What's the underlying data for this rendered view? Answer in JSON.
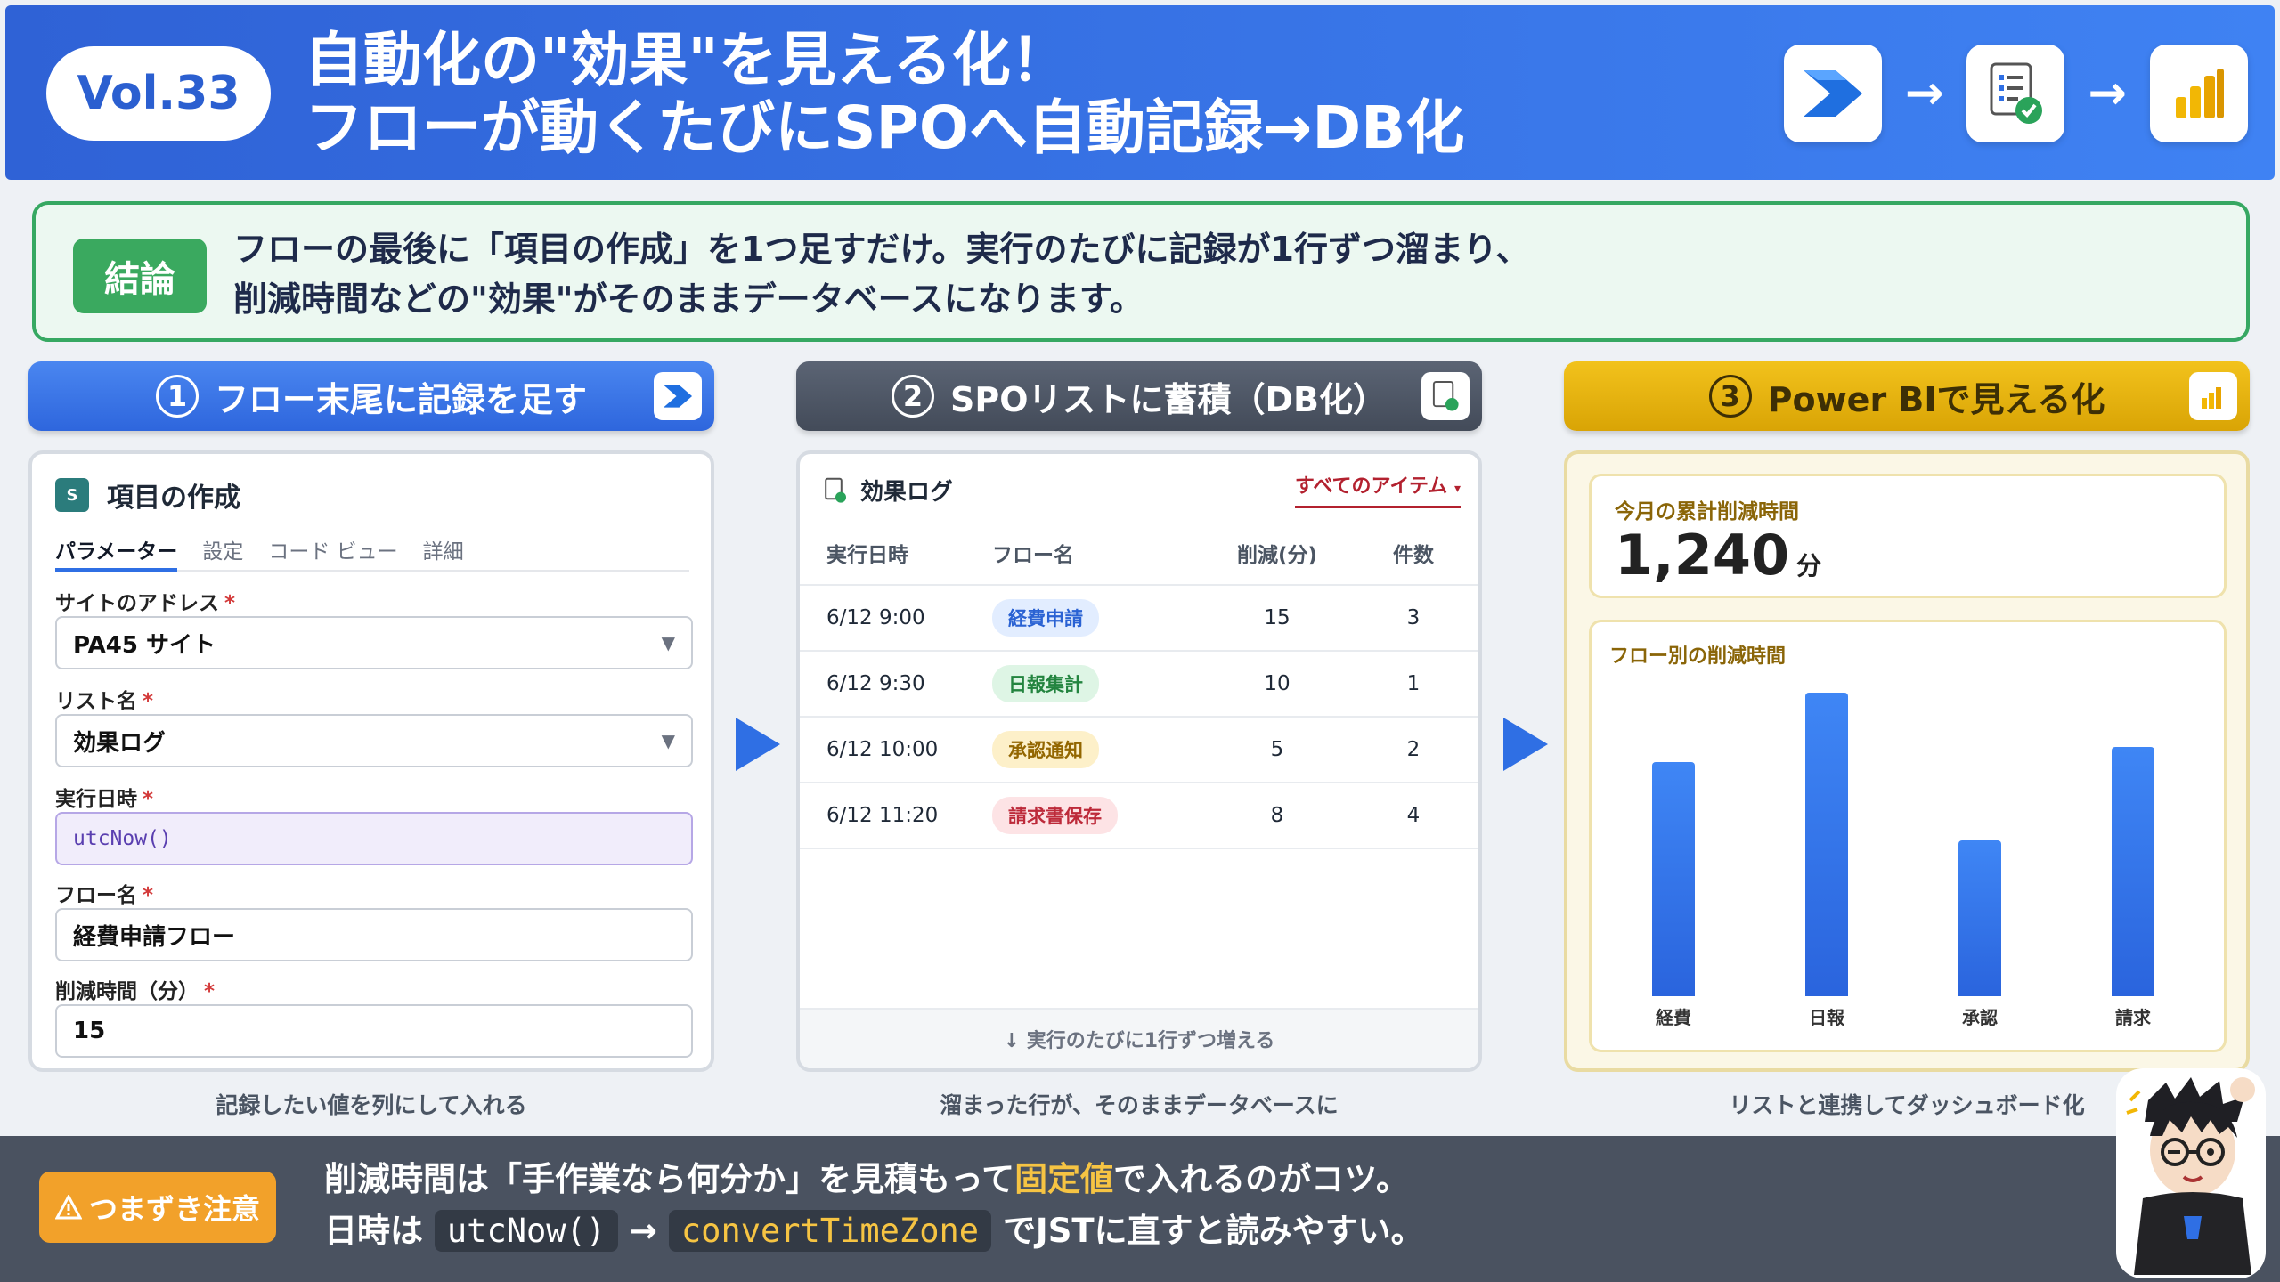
{
  "header": {
    "vol": "Vol.33",
    "title_line1": "自動化の\"効果\"を見える化！",
    "title_line2": "フローが動くたびにSPOへ自動記録→DB化",
    "arrow1": "→",
    "arrow2": "→"
  },
  "conclusion": {
    "badge": "結論",
    "line1": "フローの最後に「項目の作成」を1つ足すだけ。実行のたびに記録が1行ずつ溜まり、",
    "line2": "削減時間などの\"効果\"がそのままデータベースになります。"
  },
  "steps": [
    {
      "num": "1",
      "label": "フロー末尾に記録を足す",
      "caption": "記録したい値を列にして入れる"
    },
    {
      "num": "2",
      "label": "SPOリストに蓄積（DB化）",
      "caption": "溜まった行が、そのままデータベースに"
    },
    {
      "num": "3",
      "label": "Power BIで見える化",
      "caption": "リストと連携してダッシュボード化"
    }
  ],
  "form": {
    "title": "項目の作成",
    "tabs": [
      "パラメーター",
      "設定",
      "コード ビュー",
      "詳細"
    ],
    "required_mark": "*",
    "fields": [
      {
        "label": "サイトのアドレス",
        "value": "PA45 サイト"
      },
      {
        "label": "リスト名",
        "value": "効果ログ"
      },
      {
        "label": "実行日時",
        "value": "utcNow()"
      },
      {
        "label": "フロー名",
        "value": "経費申請フロー"
      },
      {
        "label": "削減時間（分）",
        "value": "15"
      }
    ]
  },
  "list": {
    "title": "効果ログ",
    "view": "すべてのアイテム",
    "columns": [
      "実行日時",
      "フロー名",
      "削減(分)",
      "件数"
    ],
    "rows": [
      {
        "date": "6/12 9:00",
        "flow": "経費申請",
        "min": "15",
        "count": "3"
      },
      {
        "date": "6/12 9:30",
        "flow": "日報集計",
        "min": "10",
        "count": "1"
      },
      {
        "date": "6/12 10:00",
        "flow": "承認通知",
        "min": "5",
        "count": "2"
      },
      {
        "date": "6/12 11:20",
        "flow": "請求書保存",
        "min": "8",
        "count": "4"
      }
    ],
    "footer": "↓ 実行のたびに1行ずつ増える"
  },
  "dashboard": {
    "kpi_label": "今月の累計削減時間",
    "kpi_value": "1,240",
    "kpi_unit": "分",
    "chart_title": "フロー別の削減時間"
  },
  "chart_data": {
    "type": "bar",
    "title": "フロー別の削減時間",
    "categories": [
      "経費",
      "日報",
      "承認",
      "請求"
    ],
    "values": [
      600,
      780,
      400,
      640
    ],
    "ylim": [
      0,
      800
    ],
    "grid": false,
    "colors": {
      "bar": "#2f6fe4"
    }
  },
  "footer": {
    "warn_label": "つまずき注意",
    "line1_a": "削減時間は「手作業なら何分か」を見積もって",
    "line1_hl": "固定値",
    "line1_b": "で入れるのがコツ。",
    "line2_a": "日時は",
    "code1": "utcNow()",
    "arrow": "→",
    "code2": "convertTimeZone",
    "line2_b": "でJSTに直すと読みやすい。"
  },
  "icons": [
    "power-automate-icon",
    "sharepoint-list-icon",
    "power-bi-icon",
    "warning-icon",
    "mascot-illustration"
  ],
  "colors": {
    "primary": "#2f6fe4",
    "success": "#3aa95f",
    "warning": "#f2a12a",
    "gold": "#e5b110"
  }
}
